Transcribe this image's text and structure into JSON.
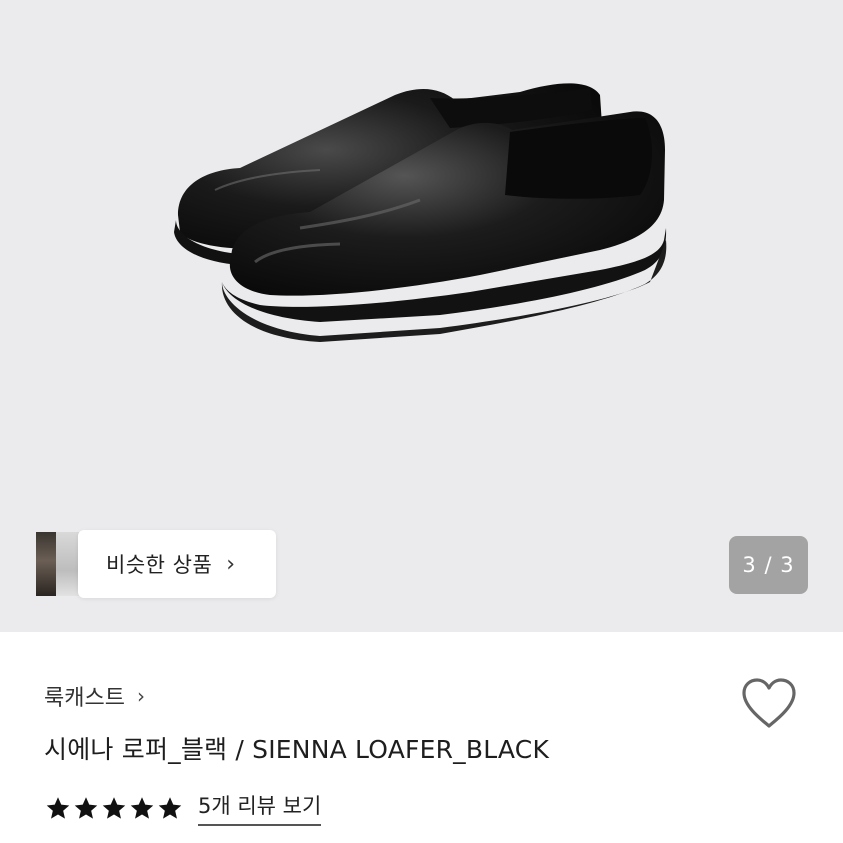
{
  "hero": {
    "image_alt": "black loafer product photo",
    "similar_button_label": "비슷한 상품",
    "similar_chevron": "chevron-right-icon",
    "page_counter": "3 / 3"
  },
  "product": {
    "brand": "룩캐스트",
    "brand_chevron": "chevron-right-icon",
    "title": "시에나 로퍼_블랙 / SIENNA LOAFER_BLACK",
    "rating_stars": 5,
    "review_link": "5개 리뷰 보기",
    "wishlist_icon": "heart-outline-icon"
  },
  "colors": {
    "hero_bg": "#ebebed",
    "counter_bg": "#a3a3a3",
    "star": "#111111"
  }
}
